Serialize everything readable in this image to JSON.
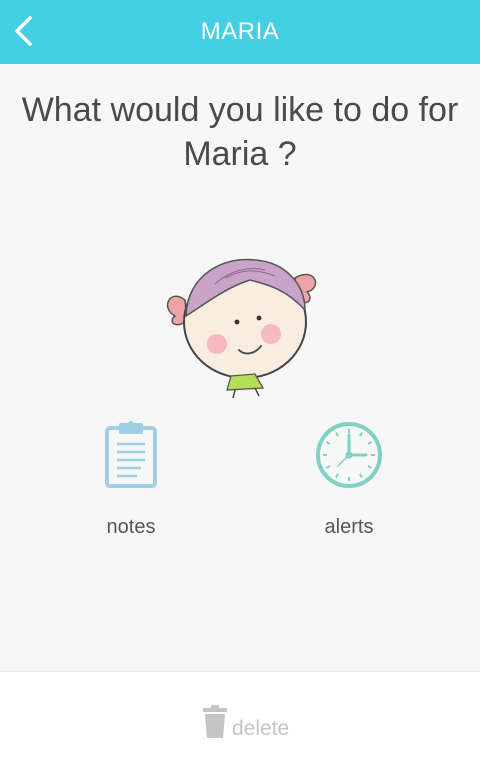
{
  "header": {
    "title": "MARIA",
    "back_icon": "chevron-left-icon",
    "background_color": "#45cfe4"
  },
  "main": {
    "question": "What would you like to do for Maria ?",
    "avatar_icon": "girl-avatar",
    "actions": [
      {
        "label": "notes",
        "icon": "clipboard-icon",
        "color": "#9ed0e2"
      },
      {
        "label": "alerts",
        "icon": "clock-icon",
        "color": "#7fd1c1"
      }
    ]
  },
  "footer": {
    "delete_label": "delete",
    "delete_icon": "trash-icon",
    "color": "#c4c4c4"
  }
}
